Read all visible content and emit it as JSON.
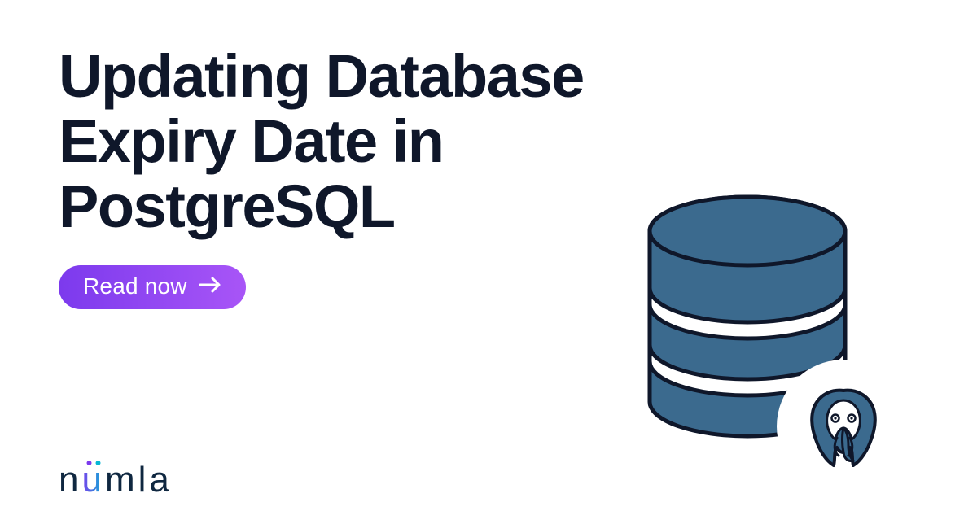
{
  "title": "Updating Database Expiry Date in PostgreSQL",
  "cta_label": "Read now",
  "brand": {
    "name": "numla"
  },
  "illustration": {
    "database_icon": "database-icon",
    "postgres_icon": "postgresql-elephant-icon"
  },
  "colors": {
    "text": "#0f172a",
    "cta_gradient_start": "#7c3aed",
    "cta_gradient_end": "#a855f7",
    "db_fill": "#3b6a8e",
    "db_stroke": "#0f172a",
    "brand_dark": "#0f2740"
  }
}
